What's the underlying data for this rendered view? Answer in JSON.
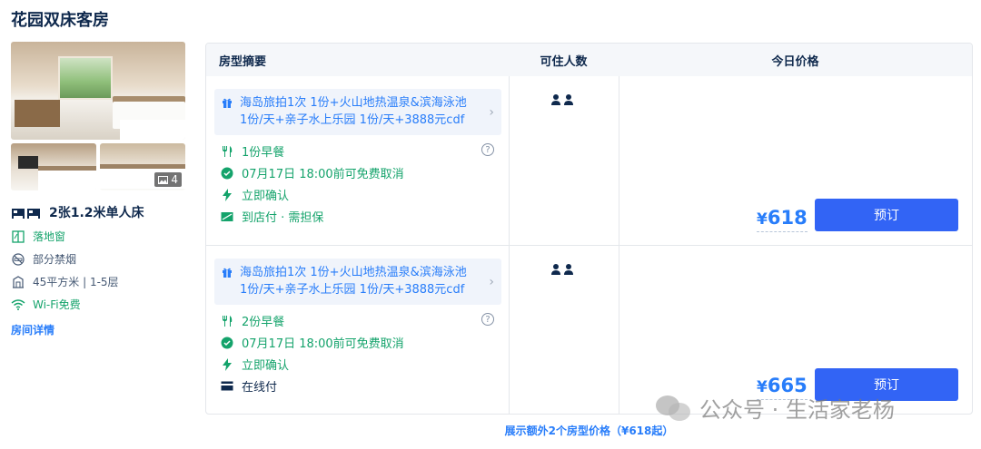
{
  "room": {
    "title": "花园双床客房",
    "photo_count": "4",
    "bed_type": "2张1.2米单人床",
    "facilities": [
      {
        "icon": "window-icon",
        "label": "落地窗"
      },
      {
        "icon": "no-smoking-icon",
        "label": "部分禁烟"
      },
      {
        "icon": "area-icon",
        "label": "45平方米 | 1-5层"
      },
      {
        "icon": "wifi-icon",
        "label": "Wi-Fi免费"
      }
    ],
    "detail_link": "房间详情"
  },
  "table": {
    "headers": {
      "summary": "房型摘要",
      "guests": "可住人数",
      "price": "今日价格"
    },
    "rows": [
      {
        "package": "海岛旅拍1次 1份+火山地热温泉&滨海泳池 1份/天+亲子水上乐园 1份/天+3888元cdf免…",
        "meal": "1份早餐",
        "cancel": "07月17日 18:00前可免费取消",
        "confirm": "立即确认",
        "payment": "到店付 · 需担保",
        "payment_icon": "pay-at-hotel-icon",
        "currency": "¥",
        "price": "618",
        "book": "预订"
      },
      {
        "package": "海岛旅拍1次 1份+火山地热温泉&滨海泳池 1份/天+亲子水上乐园 1份/天+3888元cdf免…",
        "meal": "2份早餐",
        "cancel": "07月17日 18:00前可免费取消",
        "confirm": "立即确认",
        "payment": "在线付",
        "payment_icon": "card-icon",
        "currency": "¥",
        "price": "665",
        "book": "预订"
      }
    ]
  },
  "more_link": "展示额外2个房型价格（¥618起）",
  "watermark": "公众号 · 生活家老杨",
  "colors": {
    "accent": "#287dfa",
    "button": "#3264f5",
    "green": "#14a36b",
    "text": "#0f294d",
    "muted": "#455873"
  }
}
